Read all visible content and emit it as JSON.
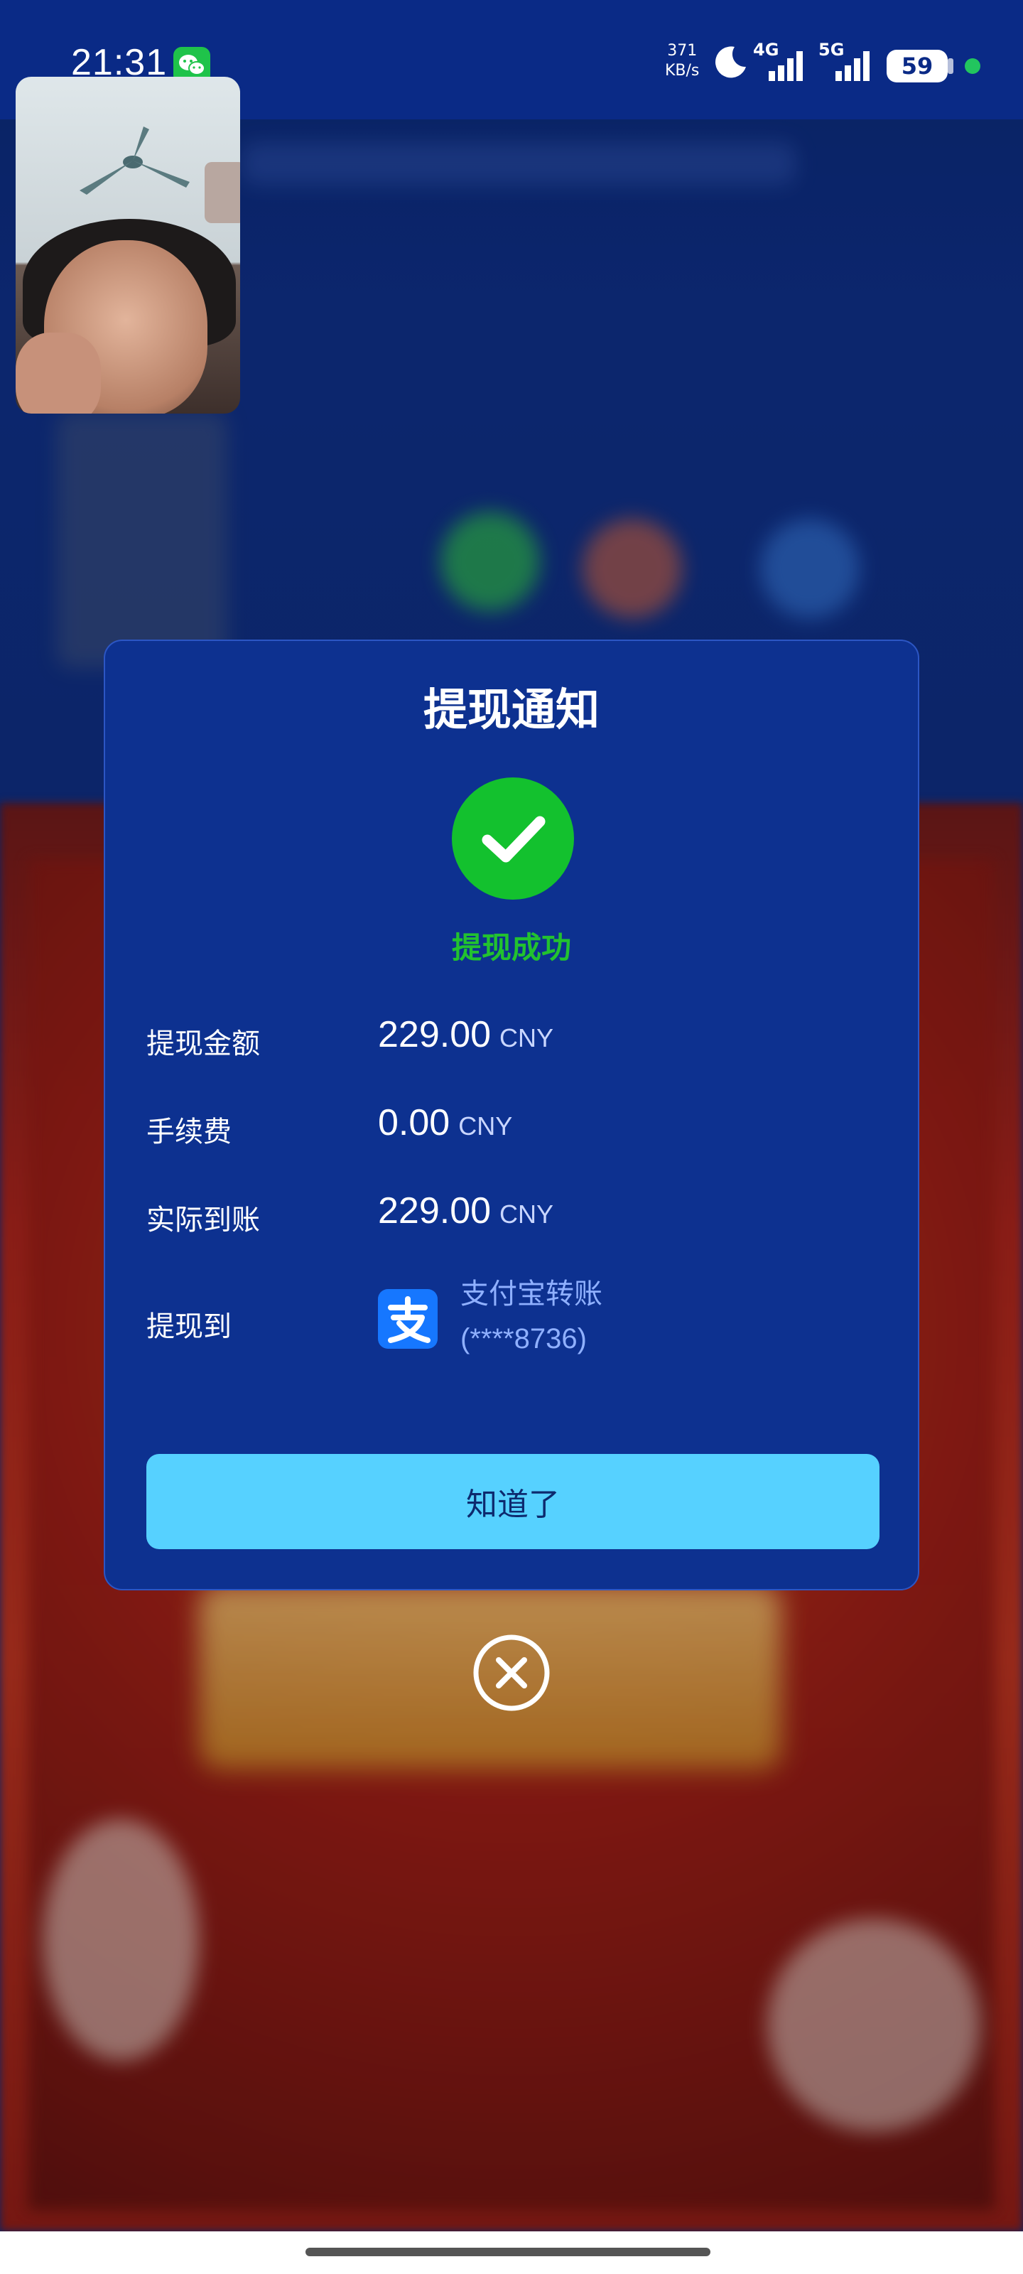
{
  "status_bar": {
    "time": "21:31",
    "net_speed_value": "371",
    "net_speed_unit": "KB/s",
    "signal_1_label": "4G",
    "signal_2_label": "5G",
    "battery_level": "59"
  },
  "dialog": {
    "title": "提现通知",
    "status_text": "提现成功",
    "rows": [
      {
        "label": "提现金额",
        "value": "229.00",
        "unit": "CNY"
      },
      {
        "label": "手续费",
        "value": "0.00",
        "unit": "CNY"
      },
      {
        "label": "实际到账",
        "value": "229.00",
        "unit": "CNY"
      }
    ],
    "withdraw_to_label": "提现到",
    "method_name": "支付宝转账",
    "method_account": "(****8736)",
    "confirm_label": "知道了"
  },
  "colors": {
    "dialog_bg": "#0d3190",
    "success": "#13c12e",
    "button": "#56d1ff",
    "alipay": "#1677ff"
  }
}
